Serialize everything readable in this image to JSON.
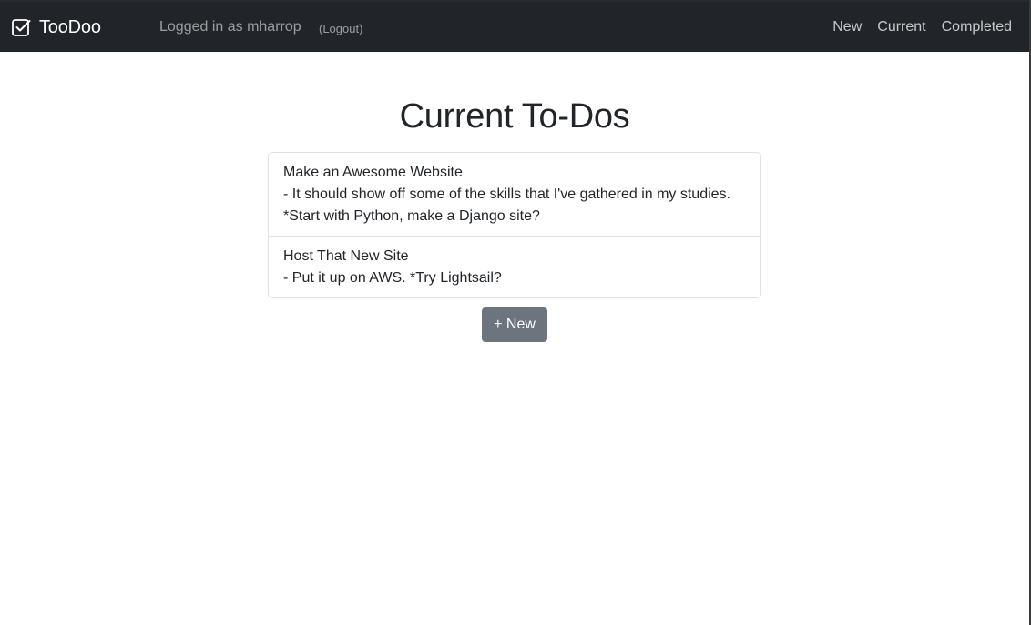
{
  "navbar": {
    "brand": "TooDoo",
    "brand_icon": "check-square-icon",
    "login_text": "Logged in as mharrop",
    "logout_label": "(Logout)",
    "links": [
      "New",
      "Current",
      "Completed"
    ]
  },
  "main": {
    "title": "Current To-Dos",
    "todos": [
      {
        "lines": [
          "Make an Awesome Website",
          "- It should show off some of the skills that I've gathered in my studies.",
          "*Start with Python, make a Django site?"
        ]
      },
      {
        "lines": [
          "Host That New Site",
          "- Put it up on AWS. *Try Lightsail?"
        ]
      }
    ],
    "new_button_label": "+ New"
  },
  "colors": {
    "navbar_bg": "#212529",
    "button_bg": "#6c757d",
    "border": "#dee2e6"
  }
}
